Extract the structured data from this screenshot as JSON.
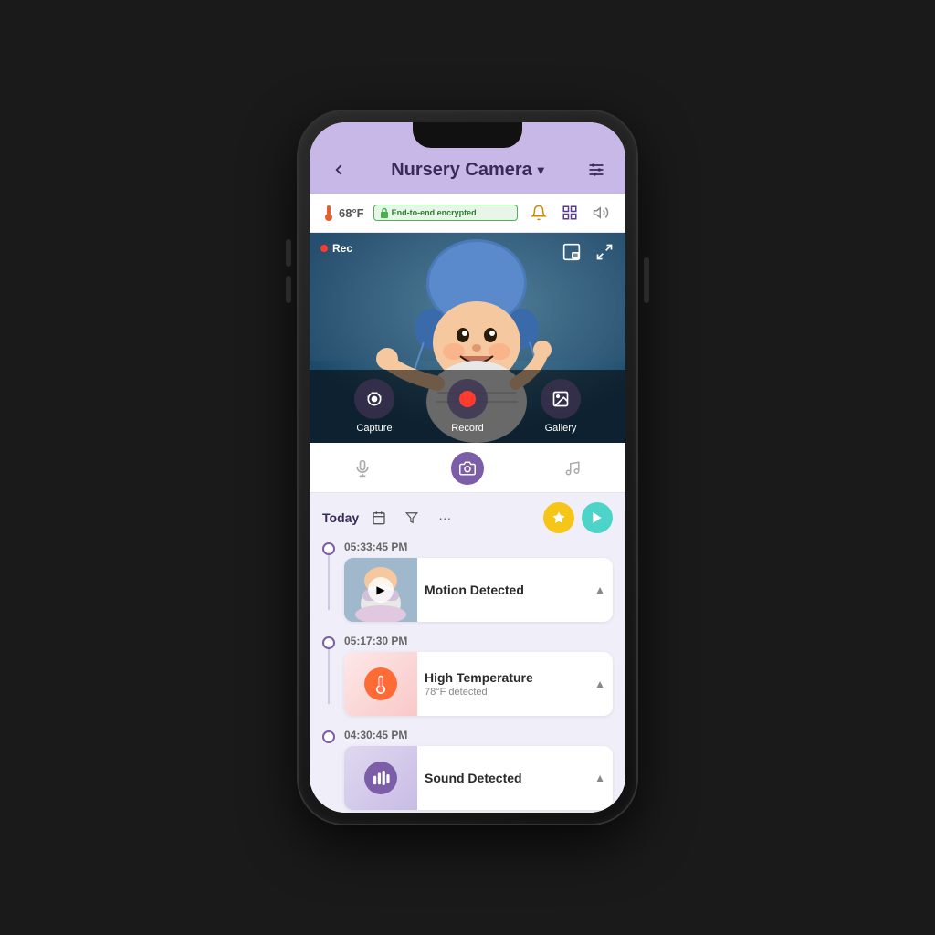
{
  "header": {
    "back_label": "‹",
    "title": "Nursery Camera",
    "title_arrow": "∨",
    "settings_label": "⚙"
  },
  "status_bar": {
    "temp": "68°F",
    "encrypt_text": "End-to-end encrypted",
    "icons": [
      "🔔",
      "📦",
      "🔊"
    ]
  },
  "camera": {
    "rec_label": "Rec",
    "overlay_buttons": [
      {
        "label": "Capture",
        "icon": "📷"
      },
      {
        "label": "Record",
        "icon": "⏺"
      },
      {
        "label": "Gallery",
        "icon": "🖼"
      }
    ]
  },
  "toolbar": {
    "icons": [
      "mic",
      "camera",
      "music"
    ]
  },
  "timeline": {
    "filter_label": "Today",
    "events": [
      {
        "time": "05:33:45 PM",
        "type": "motion",
        "title": "Motion Detected",
        "subtitle": "",
        "thumb_type": "motion"
      },
      {
        "time": "05:17:30 PM",
        "type": "temp",
        "title": "High Temperature",
        "subtitle": "78°F  detected",
        "thumb_type": "temp"
      },
      {
        "time": "04:30:45 PM",
        "type": "sound",
        "title": "Sound Detected",
        "subtitle": "",
        "thumb_type": "sound"
      }
    ]
  }
}
